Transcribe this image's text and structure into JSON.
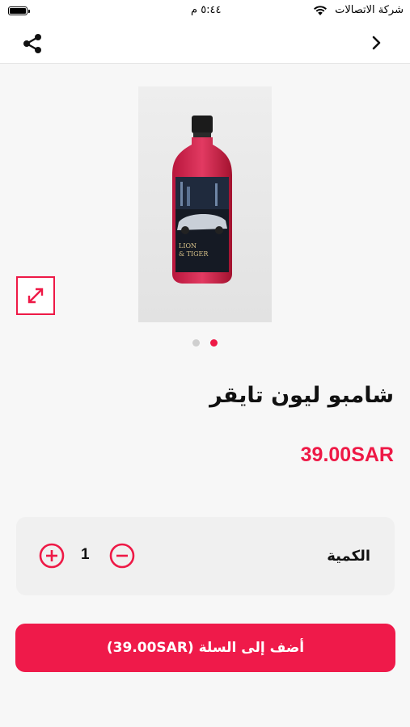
{
  "status_bar": {
    "carrier": "شركة الاتصالات",
    "time": "٥:٤٤ م",
    "battery_level": 1.0
  },
  "nav": {
    "share_icon": "share-icon",
    "back_icon": "chevron-right-icon"
  },
  "product": {
    "title": "شامبو ليون تايقر",
    "price": "39.00SAR",
    "image_label_top": "LION",
    "image_label_bottom": "& TIGER",
    "image_count": 2,
    "active_image_index": 1
  },
  "quantity": {
    "label": "الكمية",
    "value": "1",
    "plus_icon": "plus-circle-icon",
    "minus_icon": "minus-circle-icon"
  },
  "cart": {
    "add_label": "أضف إلى السلة (39.00SAR)"
  },
  "colors": {
    "accent": "#ee1946",
    "background": "#f7f7f7",
    "card": "#f0f0f0"
  }
}
